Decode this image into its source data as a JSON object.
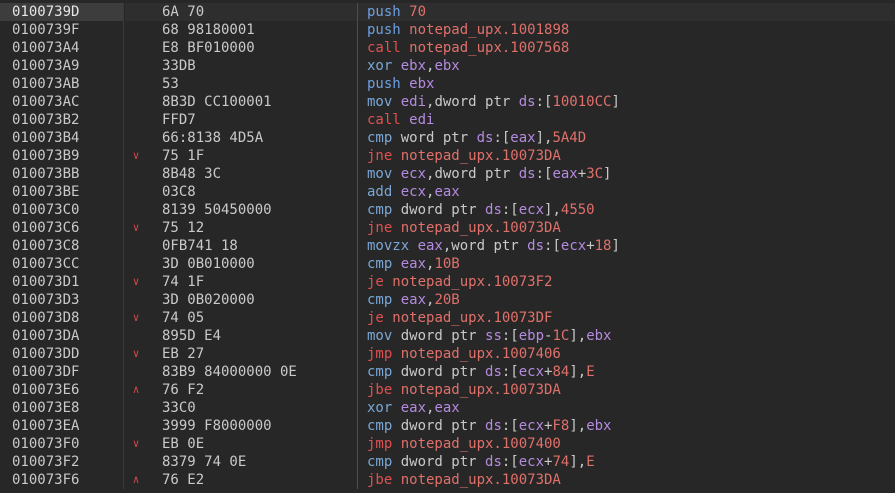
{
  "colors": {
    "background": "#272727",
    "address": "#c9c9c9",
    "bytes": "#c9c9c9",
    "mnemonic": "#7aa7d6",
    "mnemonic_push": "#6f9fe0",
    "mnemonic_branch": "#e05050",
    "register": "#b58be0",
    "immediate": "#e0706a",
    "arrow": "#d04848",
    "selected_row": "#3d3d3d"
  },
  "rows": [
    {
      "address": "0100739D",
      "arrow": "",
      "bytes": "6A 70",
      "selected": true,
      "asm": [
        {
          "t": "push ",
          "k": "mn-push"
        },
        {
          "t": "70",
          "k": "imm"
        }
      ]
    },
    {
      "address": "0100739F",
      "arrow": "",
      "bytes": "68 98180001",
      "asm": [
        {
          "t": "push ",
          "k": "mn-push"
        },
        {
          "t": "notepad_upx.1001898",
          "k": "addr"
        }
      ]
    },
    {
      "address": "010073A4",
      "arrow": "",
      "bytes": "E8 BF010000",
      "asm": [
        {
          "t": "call ",
          "k": "mn-call"
        },
        {
          "t": "notepad_upx.1007568",
          "k": "addr"
        }
      ]
    },
    {
      "address": "010073A9",
      "arrow": "",
      "bytes": "33DB",
      "asm": [
        {
          "t": "xor ",
          "k": "mn-default"
        },
        {
          "t": "ebx",
          "k": "reg"
        },
        {
          "t": ",",
          "k": "text"
        },
        {
          "t": "ebx",
          "k": "reg"
        }
      ]
    },
    {
      "address": "010073AB",
      "arrow": "",
      "bytes": "53",
      "asm": [
        {
          "t": "push ",
          "k": "mn-push"
        },
        {
          "t": "ebx",
          "k": "reg"
        }
      ]
    },
    {
      "address": "010073AC",
      "arrow": "",
      "bytes": "8B3D CC100001",
      "asm": [
        {
          "t": "mov ",
          "k": "mn-default"
        },
        {
          "t": "edi",
          "k": "reg"
        },
        {
          "t": ",dword ptr ",
          "k": "text"
        },
        {
          "t": "ds",
          "k": "seg"
        },
        {
          "t": ":[",
          "k": "text"
        },
        {
          "t": "10010CC",
          "k": "imm"
        },
        {
          "t": "]",
          "k": "text"
        }
      ]
    },
    {
      "address": "010073B2",
      "arrow": "",
      "bytes": "FFD7",
      "asm": [
        {
          "t": "call ",
          "k": "mn-call"
        },
        {
          "t": "edi",
          "k": "reg"
        }
      ]
    },
    {
      "address": "010073B4",
      "arrow": "",
      "bytes": "66:8138 4D5A",
      "asm": [
        {
          "t": "cmp ",
          "k": "mn-default"
        },
        {
          "t": "word ptr ",
          "k": "text"
        },
        {
          "t": "ds",
          "k": "seg"
        },
        {
          "t": ":[",
          "k": "text"
        },
        {
          "t": "eax",
          "k": "reg"
        },
        {
          "t": "],",
          "k": "text"
        },
        {
          "t": "5A4D",
          "k": "imm"
        }
      ]
    },
    {
      "address": "010073B9",
      "arrow": "down",
      "bytes": "75 1F",
      "asm": [
        {
          "t": "jne ",
          "k": "mn-jcc"
        },
        {
          "t": "notepad_upx.10073DA",
          "k": "addr"
        }
      ]
    },
    {
      "address": "010073BB",
      "arrow": "",
      "bytes": "8B48 3C",
      "asm": [
        {
          "t": "mov ",
          "k": "mn-default"
        },
        {
          "t": "ecx",
          "k": "reg"
        },
        {
          "t": ",dword ptr ",
          "k": "text"
        },
        {
          "t": "ds",
          "k": "seg"
        },
        {
          "t": ":[",
          "k": "text"
        },
        {
          "t": "eax",
          "k": "reg"
        },
        {
          "t": "+",
          "k": "text"
        },
        {
          "t": "3C",
          "k": "imm"
        },
        {
          "t": "]",
          "k": "text"
        }
      ]
    },
    {
      "address": "010073BE",
      "arrow": "",
      "bytes": "03C8",
      "asm": [
        {
          "t": "add ",
          "k": "mn-default"
        },
        {
          "t": "ecx",
          "k": "reg"
        },
        {
          "t": ",",
          "k": "text"
        },
        {
          "t": "eax",
          "k": "reg"
        }
      ]
    },
    {
      "address": "010073C0",
      "arrow": "",
      "bytes": "8139 50450000",
      "asm": [
        {
          "t": "cmp ",
          "k": "mn-default"
        },
        {
          "t": "dword ptr ",
          "k": "text"
        },
        {
          "t": "ds",
          "k": "seg"
        },
        {
          "t": ":[",
          "k": "text"
        },
        {
          "t": "ecx",
          "k": "reg"
        },
        {
          "t": "],",
          "k": "text"
        },
        {
          "t": "4550",
          "k": "imm"
        }
      ]
    },
    {
      "address": "010073C6",
      "arrow": "down",
      "bytes": "75 12",
      "asm": [
        {
          "t": "jne ",
          "k": "mn-jcc"
        },
        {
          "t": "notepad_upx.10073DA",
          "k": "addr"
        }
      ]
    },
    {
      "address": "010073C8",
      "arrow": "",
      "bytes": "0FB741 18",
      "asm": [
        {
          "t": "movzx ",
          "k": "mn-default"
        },
        {
          "t": "eax",
          "k": "reg"
        },
        {
          "t": ",word ptr ",
          "k": "text"
        },
        {
          "t": "ds",
          "k": "seg"
        },
        {
          "t": ":[",
          "k": "text"
        },
        {
          "t": "ecx",
          "k": "reg"
        },
        {
          "t": "+",
          "k": "text"
        },
        {
          "t": "18",
          "k": "imm"
        },
        {
          "t": "]",
          "k": "text"
        }
      ]
    },
    {
      "address": "010073CC",
      "arrow": "",
      "bytes": "3D 0B010000",
      "asm": [
        {
          "t": "cmp ",
          "k": "mn-default"
        },
        {
          "t": "eax",
          "k": "reg"
        },
        {
          "t": ",",
          "k": "text"
        },
        {
          "t": "10B",
          "k": "imm"
        }
      ]
    },
    {
      "address": "010073D1",
      "arrow": "down",
      "bytes": "74 1F",
      "asm": [
        {
          "t": "je ",
          "k": "mn-jcc"
        },
        {
          "t": "notepad_upx.10073F2",
          "k": "addr"
        }
      ]
    },
    {
      "address": "010073D3",
      "arrow": "",
      "bytes": "3D 0B020000",
      "asm": [
        {
          "t": "cmp ",
          "k": "mn-default"
        },
        {
          "t": "eax",
          "k": "reg"
        },
        {
          "t": ",",
          "k": "text"
        },
        {
          "t": "20B",
          "k": "imm"
        }
      ]
    },
    {
      "address": "010073D8",
      "arrow": "down",
      "bytes": "74 05",
      "asm": [
        {
          "t": "je ",
          "k": "mn-jcc"
        },
        {
          "t": "notepad_upx.10073DF",
          "k": "addr"
        }
      ]
    },
    {
      "address": "010073DA",
      "arrow": "",
      "bytes": "895D E4",
      "asm": [
        {
          "t": "mov ",
          "k": "mn-default"
        },
        {
          "t": "dword ptr ",
          "k": "text"
        },
        {
          "t": "ss",
          "k": "seg"
        },
        {
          "t": ":[",
          "k": "text"
        },
        {
          "t": "ebp",
          "k": "reg"
        },
        {
          "t": "-",
          "k": "text"
        },
        {
          "t": "1C",
          "k": "imm"
        },
        {
          "t": "],",
          "k": "text"
        },
        {
          "t": "ebx",
          "k": "reg"
        }
      ]
    },
    {
      "address": "010073DD",
      "arrow": "down",
      "bytes": "EB 27",
      "asm": [
        {
          "t": "jmp ",
          "k": "mn-jmp"
        },
        {
          "t": "notepad_upx.1007406",
          "k": "addr"
        }
      ]
    },
    {
      "address": "010073DF",
      "arrow": "",
      "bytes": "83B9 84000000 0E",
      "asm": [
        {
          "t": "cmp ",
          "k": "mn-default"
        },
        {
          "t": "dword ptr ",
          "k": "text"
        },
        {
          "t": "ds",
          "k": "seg"
        },
        {
          "t": ":[",
          "k": "text"
        },
        {
          "t": "ecx",
          "k": "reg"
        },
        {
          "t": "+",
          "k": "text"
        },
        {
          "t": "84",
          "k": "imm"
        },
        {
          "t": "],",
          "k": "text"
        },
        {
          "t": "E",
          "k": "imm"
        }
      ]
    },
    {
      "address": "010073E6",
      "arrow": "up",
      "bytes": "76 F2",
      "asm": [
        {
          "t": "jbe ",
          "k": "mn-jcc"
        },
        {
          "t": "notepad_upx.10073DA",
          "k": "addr"
        }
      ]
    },
    {
      "address": "010073E8",
      "arrow": "",
      "bytes": "33C0",
      "asm": [
        {
          "t": "xor ",
          "k": "mn-default"
        },
        {
          "t": "eax",
          "k": "reg"
        },
        {
          "t": ",",
          "k": "text"
        },
        {
          "t": "eax",
          "k": "reg"
        }
      ]
    },
    {
      "address": "010073EA",
      "arrow": "",
      "bytes": "3999 F8000000",
      "asm": [
        {
          "t": "cmp ",
          "k": "mn-default"
        },
        {
          "t": "dword ptr ",
          "k": "text"
        },
        {
          "t": "ds",
          "k": "seg"
        },
        {
          "t": ":[",
          "k": "text"
        },
        {
          "t": "ecx",
          "k": "reg"
        },
        {
          "t": "+",
          "k": "text"
        },
        {
          "t": "F8",
          "k": "imm"
        },
        {
          "t": "],",
          "k": "text"
        },
        {
          "t": "ebx",
          "k": "reg"
        }
      ]
    },
    {
      "address": "010073F0",
      "arrow": "down",
      "bytes": "EB 0E",
      "asm": [
        {
          "t": "jmp ",
          "k": "mn-jmp"
        },
        {
          "t": "notepad_upx.1007400",
          "k": "addr"
        }
      ]
    },
    {
      "address": "010073F2",
      "arrow": "",
      "bytes": "8379 74 0E",
      "asm": [
        {
          "t": "cmp ",
          "k": "mn-default"
        },
        {
          "t": "dword ptr ",
          "k": "text"
        },
        {
          "t": "ds",
          "k": "seg"
        },
        {
          "t": ":[",
          "k": "text"
        },
        {
          "t": "ecx",
          "k": "reg"
        },
        {
          "t": "+",
          "k": "text"
        },
        {
          "t": "74",
          "k": "imm"
        },
        {
          "t": "],",
          "k": "text"
        },
        {
          "t": "E",
          "k": "imm"
        }
      ]
    },
    {
      "address": "010073F6",
      "arrow": "up",
      "bytes": "76 E2",
      "asm": [
        {
          "t": "jbe ",
          "k": "mn-jcc"
        },
        {
          "t": "notepad_upx.10073DA",
          "k": "addr"
        }
      ]
    }
  ]
}
